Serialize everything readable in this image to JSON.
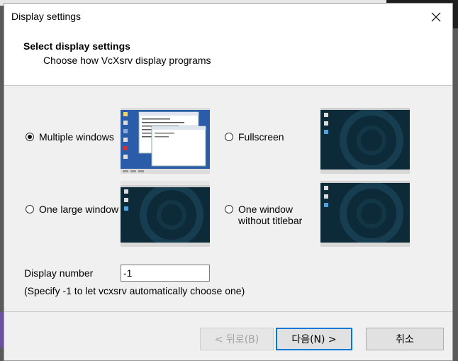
{
  "window": {
    "title": "Display settings"
  },
  "header": {
    "title": "Select display settings",
    "subtitle": "Choose how VcXsrv display programs"
  },
  "options": [
    {
      "id": "multiple",
      "label": "Multiple windows",
      "selected": true
    },
    {
      "id": "fullscreen",
      "label": "Fullscreen",
      "selected": false
    },
    {
      "id": "one_large",
      "label": "One large window",
      "selected": false
    },
    {
      "id": "no_titlebar",
      "label_line1": "One window",
      "label_line2": "without titlebar",
      "selected": false
    }
  ],
  "display_number": {
    "label": "Display number",
    "value": "-1",
    "hint": "(Specify -1 to let vcxsrv automatically choose one)"
  },
  "buttons": {
    "back": "< 뒤로(B)",
    "next": "다음(N) >",
    "cancel": "취소"
  },
  "colors": {
    "desktop_dark": "#0d2a38",
    "desktop_blue": "#2a5caa",
    "focus": "#0078d7"
  },
  "icons": {
    "close": "close-icon"
  }
}
